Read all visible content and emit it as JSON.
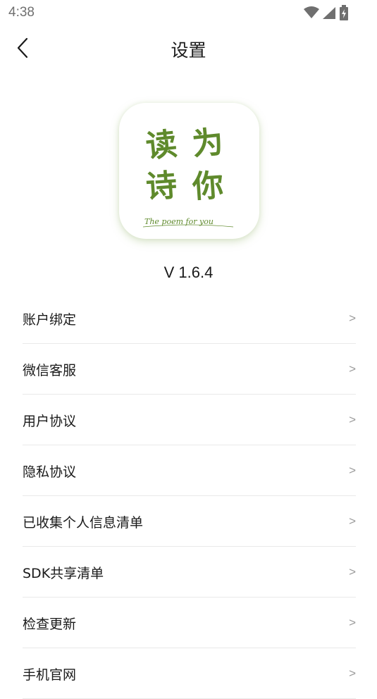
{
  "status_bar": {
    "time": "4:38",
    "icons": [
      "wifi-icon",
      "cell-signal-icon",
      "battery-charging-icon"
    ]
  },
  "nav": {
    "title": "设置",
    "back_icon": "chevron-left-icon"
  },
  "logo": {
    "text": "读为诗你",
    "tagline": "The poem for you",
    "accent_color": "#5f8a2c"
  },
  "version": "V 1.6.4",
  "menu": {
    "items": [
      {
        "label": "账户绑定",
        "arrow": ">"
      },
      {
        "label": "微信客服",
        "arrow": ">"
      },
      {
        "label": "用户协议",
        "arrow": ">"
      },
      {
        "label": "隐私协议",
        "arrow": ">"
      },
      {
        "label": "已收集个人信息清单",
        "arrow": ">"
      },
      {
        "label": "SDK共享清单",
        "arrow": ">"
      },
      {
        "label": "检查更新",
        "arrow": ">"
      },
      {
        "label": "手机官网",
        "arrow": ">"
      }
    ]
  }
}
